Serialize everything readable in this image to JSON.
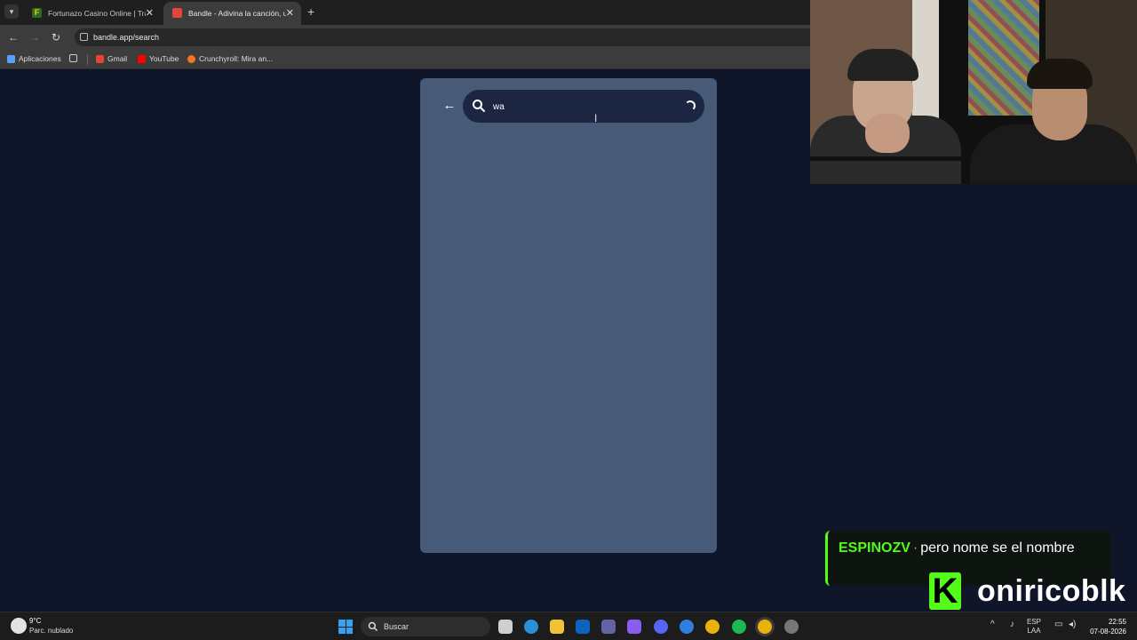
{
  "browser": {
    "tabs": [
      {
        "title": "Fortunazo Casino Online | Tragamonedas",
        "favicon_color": "#f5d000",
        "active": false
      },
      {
        "title": "Bandle - Adivina la canción, un",
        "favicon_color": "#e0463c",
        "active": true
      }
    ],
    "address": "bandle.app/search",
    "bookmarks": [
      {
        "label": "Aplicaciones",
        "icon": "apps-grid-icon"
      },
      {
        "label": "Gmail",
        "icon": "gmail-icon"
      },
      {
        "label": "YouTube",
        "icon": "youtube-icon"
      },
      {
        "label": "Crunchyroll: Mira an...",
        "icon": "crunchyroll-icon"
      }
    ]
  },
  "search": {
    "value": "wa",
    "placeholder": ""
  },
  "chat": {
    "username": "ESPINOZV",
    "separator": "·",
    "message": "pero nome se el nombre"
  },
  "brand": {
    "letter": "K",
    "name": "onirico",
    "name_suffix": "blk"
  },
  "taskbar": {
    "weather_temp": "9°C",
    "weather_desc": "Parc. nublado",
    "search_label": "Buscar",
    "lang_top": "ESP",
    "lang_bottom": "LAA",
    "time": "22:55",
    "date": "07-08-2026"
  },
  "colors": {
    "page_bg": "#0f1629",
    "panel_bg": "#475a78",
    "search_bg": "#1c2541",
    "kick_green": "#53fc18"
  }
}
